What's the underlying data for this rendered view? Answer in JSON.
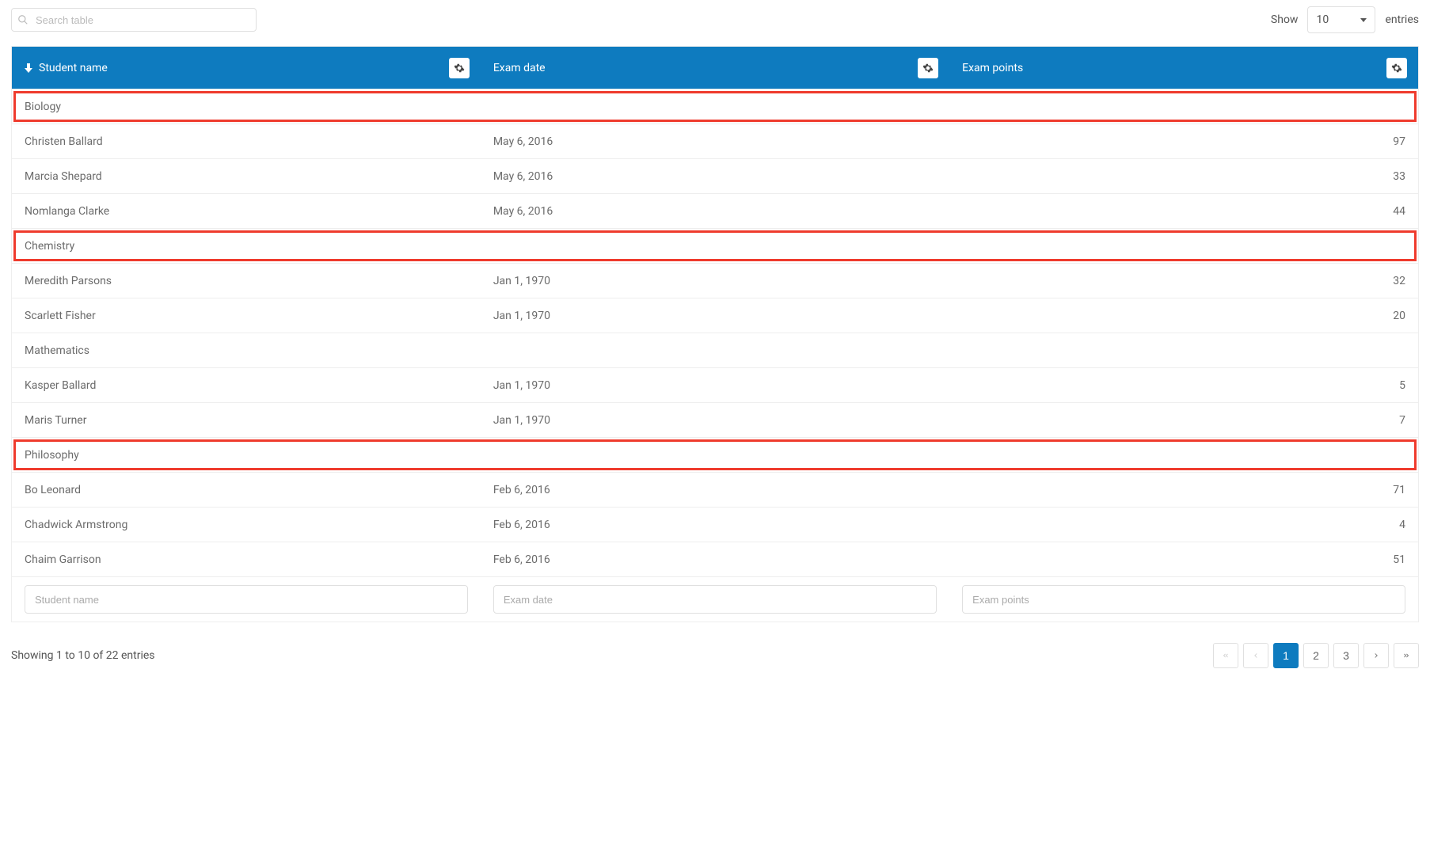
{
  "search": {
    "placeholder": "Search table"
  },
  "show": {
    "label_before": "Show",
    "value": "10",
    "label_after": "entries"
  },
  "columns": {
    "name": {
      "label": "Student name",
      "filter_placeholder": "Student name"
    },
    "date": {
      "label": "Exam date",
      "filter_placeholder": "Exam date"
    },
    "points": {
      "label": "Exam points",
      "filter_placeholder": "Exam points"
    }
  },
  "rows": [
    {
      "type": "group",
      "label": "Biology",
      "highlighted": true
    },
    {
      "type": "data",
      "name": "Christen Ballard",
      "date": "May 6, 2016",
      "points": "97"
    },
    {
      "type": "data",
      "name": "Marcia Shepard",
      "date": "May 6, 2016",
      "points": "33"
    },
    {
      "type": "data",
      "name": "Nomlanga Clarke",
      "date": "May 6, 2016",
      "points": "44"
    },
    {
      "type": "group",
      "label": "Chemistry",
      "highlighted": true
    },
    {
      "type": "data",
      "name": "Meredith Parsons",
      "date": "Jan 1, 1970",
      "points": "32"
    },
    {
      "type": "data",
      "name": "Scarlett Fisher",
      "date": "Jan 1, 1970",
      "points": "20"
    },
    {
      "type": "group",
      "label": "Mathematics",
      "highlighted": false
    },
    {
      "type": "data",
      "name": "Kasper Ballard",
      "date": "Jan 1, 1970",
      "points": "5"
    },
    {
      "type": "data",
      "name": "Maris Turner",
      "date": "Jan 1, 1970",
      "points": "7"
    },
    {
      "type": "group",
      "label": "Philosophy",
      "highlighted": true
    },
    {
      "type": "data",
      "name": "Bo Leonard",
      "date": "Feb 6, 2016",
      "points": "71"
    },
    {
      "type": "data",
      "name": "Chadwick Armstrong",
      "date": "Feb 6, 2016",
      "points": "4"
    },
    {
      "type": "data",
      "name": "Chaim Garrison",
      "date": "Feb 6, 2016",
      "points": "51"
    }
  ],
  "info": "Showing 1 to 10 of 22 entries",
  "pager": {
    "pages": [
      "1",
      "2",
      "3"
    ],
    "active": "1"
  }
}
